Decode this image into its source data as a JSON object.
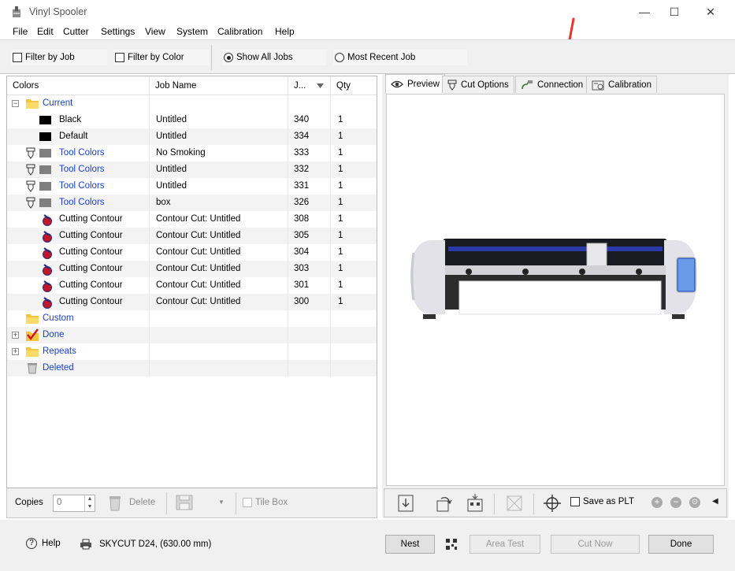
{
  "window": {
    "title": "Vinyl Spooler",
    "controls": [
      "—",
      "☐",
      "✕"
    ]
  },
  "menu": [
    "File",
    "Edit",
    "Cutter",
    "Settings",
    "View",
    "System",
    "Calibration",
    "Help"
  ],
  "toolbar": {
    "filter_by_job": "Filter by Job",
    "filter_by_color": "Filter by Color",
    "show_all_jobs": "Show All Jobs",
    "most_recent_job": "Most Recent Job"
  },
  "grid": {
    "headers": [
      "Colors",
      "Job Name",
      "J...",
      "Qty"
    ],
    "rows": [
      {
        "color": "Current",
        "job": "",
        "num": "",
        "qty": ""
      },
      {
        "color": "Black",
        "job": "Untitled",
        "num": "340",
        "qty": "1"
      },
      {
        "color": "Default",
        "job": "Untitled",
        "num": "334",
        "qty": "1"
      },
      {
        "color": "Tool Colors",
        "job": "No Smoking",
        "num": "333",
        "qty": "1"
      },
      {
        "color": "Tool Colors",
        "job": "Untitled",
        "num": "332",
        "qty": "1"
      },
      {
        "color": "Tool Colors",
        "job": "Untitled",
        "num": "331",
        "qty": "1"
      },
      {
        "color": "Tool Colors",
        "job": "box",
        "num": "326",
        "qty": "1"
      },
      {
        "color": "Cutting Contour",
        "job": "Contour Cut: Untitled",
        "num": "308",
        "qty": "1"
      },
      {
        "color": "Cutting Contour",
        "job": "Contour Cut: Untitled",
        "num": "305",
        "qty": "1"
      },
      {
        "color": "Cutting Contour",
        "job": "Contour Cut: Untitled",
        "num": "304",
        "qty": "1"
      },
      {
        "color": "Cutting Contour",
        "job": "Contour Cut: Untitled",
        "num": "303",
        "qty": "1"
      },
      {
        "color": "Cutting Contour",
        "job": "Contour Cut: Untitled",
        "num": "301",
        "qty": "1"
      },
      {
        "color": "Cutting Contour",
        "job": "Contour Cut: Untitled",
        "num": "300",
        "qty": "1"
      },
      {
        "color": "Custom",
        "job": "",
        "num": "",
        "qty": ""
      },
      {
        "color": "Done",
        "job": "",
        "num": "",
        "qty": ""
      },
      {
        "color": "Repeats",
        "job": "",
        "num": "",
        "qty": ""
      },
      {
        "color": "Deleted",
        "job": "",
        "num": "",
        "qty": ""
      }
    ]
  },
  "copies_bar": {
    "copies_label": "Copies",
    "copies_value": "0",
    "delete_label": "Delete",
    "tile_box_label": "Tile Box"
  },
  "tabs": {
    "preview": "Preview",
    "cut_options": "Cut Options",
    "connection": "Connection",
    "calibration": "Calibration"
  },
  "preview_toolbar": {
    "save_as_plt": "Save as PLT"
  },
  "status": {
    "help": "Help",
    "device": "SKYCUT D24,  (630.00 mm)",
    "nest": "Nest",
    "area_test": "Area Test",
    "cut_now": "Cut Now",
    "done": "Done"
  },
  "colors": {
    "link_blue": "#1a40c4",
    "annotation_red": "#e8352b"
  }
}
